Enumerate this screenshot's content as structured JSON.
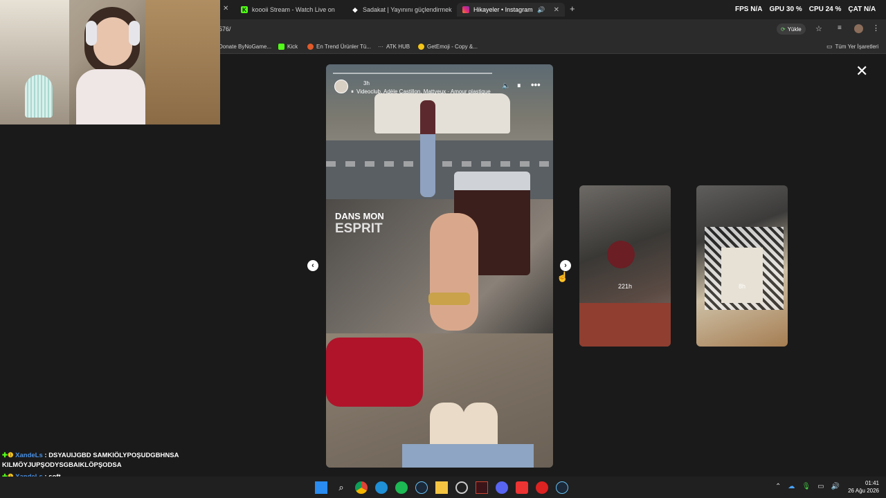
{
  "taskbar_overlay": {
    "fps_label": "FPS",
    "fps_value": "N/A",
    "gpu_label": "GPU",
    "gpu_value": "30 %",
    "cpu_label": "CPU",
    "cpu_value": "24 %",
    "sat_label": "ÇAT",
    "sat_value": "N/A"
  },
  "tabs": [
    {
      "label": "koooii Stream - Watch Live on",
      "favicon": "kick-icon",
      "active": false
    },
    {
      "label": "Sadakat | Yayınını güçlendirmek",
      "favicon": "diamond-icon",
      "active": false
    },
    {
      "label": "Hikayeler • Instagram",
      "favicon": "instagram-icon",
      "active": true
    }
  ],
  "url": "576/",
  "url_actions": {
    "update_label": "Yükle"
  },
  "bookmarks": [
    {
      "label": "Donate ByNoGame..."
    },
    {
      "label": "Kick"
    },
    {
      "label": "En Trend Ürünler Tü..."
    },
    {
      "label": "ATK HUB"
    },
    {
      "label": "GetEmoji - Copy &..."
    }
  ],
  "all_bookmarks_label": "Tüm Yer İşaretleri",
  "story": {
    "time": "3h",
    "music": "Videoclub, Adèle Castillon, Mattyeux · Amour plastique",
    "overlay_line1": "DANS MON",
    "overlay_line2": "ESPRIT"
  },
  "thumbnails": [
    {
      "label": "221h"
    },
    {
      "label": "8h"
    }
  ],
  "chat": [
    {
      "user": "XandeLs",
      "message": ": DSYAUIJGBD SAMKIÖLYPOŞUDGBHNSA",
      "continuation": "KILMÖYJUPŞODYSGBAIKLÖPŞODSA"
    },
    {
      "user": "XandeLs",
      "message": ": soft",
      "continuation": ""
    }
  ],
  "clock": {
    "time": "01:41",
    "date": "26 Ağu 2026"
  },
  "colors": {
    "accent_green": "#53fc18",
    "instagram": "#e1306c",
    "chat_user": "#4a90e2"
  }
}
